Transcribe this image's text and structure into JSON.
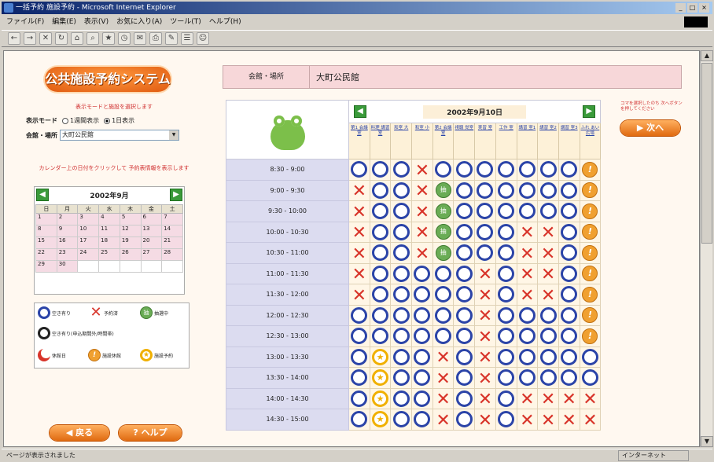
{
  "window": {
    "title": "一括予約 施設予約 - Microsoft Internet Explorer",
    "controls": [
      "_",
      "□",
      "×"
    ]
  },
  "menu": [
    "ファイル(F)",
    "編集(E)",
    "表示(V)",
    "お気に入り(A)",
    "ツール(T)",
    "ヘルプ(H)"
  ],
  "status": {
    "left": "ページが表示されました",
    "zone": "インターネット"
  },
  "left": {
    "logo": "公共施設予約システム",
    "instruction1": "表示モードと施設を選択します",
    "mode_label": "表示モード",
    "mode_options": [
      "1週間表示",
      "1日表示"
    ],
    "hall_label": "会館・場所",
    "hall_value": "大町公民館",
    "instruction2": "カレンダー上の日付をクリックして 予約表情報を表示します",
    "calendar": {
      "title": "2002年9月",
      "weekdays": [
        "日",
        "月",
        "火",
        "水",
        "木",
        "金",
        "土"
      ],
      "weeks": [
        [
          "1",
          "2",
          "3",
          "4",
          "5",
          "6",
          "7"
        ],
        [
          "8",
          "9",
          "10",
          "11",
          "12",
          "13",
          "14"
        ],
        [
          "15",
          "16",
          "17",
          "18",
          "19",
          "20",
          "21"
        ],
        [
          "22",
          "23",
          "24",
          "25",
          "26",
          "27",
          "28"
        ],
        [
          "29",
          "30",
          "",
          "",
          "",
          "",
          ""
        ]
      ]
    },
    "legend": {
      "available": "空き有り",
      "booked": "予約済",
      "pending": "抽選中",
      "partial": "空き有り(申込期間外/時間帯)",
      "closed": "休館日",
      "holiday": "施設休館",
      "sponsored": "施設予約"
    },
    "back_button": "戻る",
    "help_button": "ヘルプ"
  },
  "right": {
    "venue_label": "会館・場所",
    "venue_value": "大町公民館",
    "date_title": "2002年9月10日",
    "next_note": "コマを選択したのち 次へボタンを押してください",
    "next_button": "次へ",
    "rooms": [
      "第1 会議室",
      "料理 講習室",
      "和室 大",
      "和室 小",
      "第2 会議室",
      "視聴 覚室",
      "実習 室",
      "工作 室",
      "講習 室1",
      "講習 室2",
      "講習 室3",
      "ふれ あい 広場"
    ],
    "slots": [
      {
        "time": "8:30 - 9:00",
        "cells": [
          "o",
          "o",
          "o",
          "x",
          "o",
          "o",
          "o",
          "o",
          "o",
          "o",
          "o",
          "!"
        ]
      },
      {
        "time": "9:00 - 9:30",
        "cells": [
          "x",
          "o",
          "o",
          "x",
          "g",
          "o",
          "o",
          "o",
          "o",
          "o",
          "o",
          "!"
        ]
      },
      {
        "time": "9:30 - 10:00",
        "cells": [
          "x",
          "o",
          "o",
          "x",
          "g",
          "o",
          "o",
          "o",
          "o",
          "o",
          "o",
          "!"
        ]
      },
      {
        "time": "10:00 - 10:30",
        "cells": [
          "x",
          "o",
          "o",
          "x",
          "g",
          "o",
          "o",
          "o",
          "x",
          "x",
          "o",
          "!"
        ]
      },
      {
        "time": "10:30 - 11:00",
        "cells": [
          "x",
          "o",
          "o",
          "x",
          "g",
          "o",
          "o",
          "o",
          "x",
          "x",
          "o",
          "!"
        ]
      },
      {
        "time": "11:00 - 11:30",
        "cells": [
          "x",
          "o",
          "o",
          "o",
          "o",
          "o",
          "x",
          "o",
          "x",
          "x",
          "o",
          "!"
        ]
      },
      {
        "time": "11:30 - 12:00",
        "cells": [
          "x",
          "o",
          "o",
          "o",
          "o",
          "o",
          "x",
          "o",
          "x",
          "x",
          "o",
          "!"
        ]
      },
      {
        "time": "12:00 - 12:30",
        "cells": [
          "o",
          "o",
          "o",
          "o",
          "o",
          "o",
          "x",
          "o",
          "o",
          "o",
          "o",
          "!"
        ]
      },
      {
        "time": "12:30 - 13:00",
        "cells": [
          "o",
          "o",
          "o",
          "o",
          "o",
          "o",
          "x",
          "o",
          "o",
          "o",
          "o",
          "!"
        ]
      },
      {
        "time": "13:00 - 13:30",
        "cells": [
          "o",
          "s",
          "o",
          "o",
          "x",
          "o",
          "x",
          "o",
          "o",
          "o",
          "o",
          "o"
        ]
      },
      {
        "time": "13:30 - 14:00",
        "cells": [
          "o",
          "s",
          "o",
          "o",
          "x",
          "o",
          "x",
          "o",
          "o",
          "o",
          "o",
          "o"
        ]
      },
      {
        "time": "14:00 - 14:30",
        "cells": [
          "o",
          "s",
          "o",
          "o",
          "x",
          "o",
          "x",
          "o",
          "x",
          "x",
          "x",
          "x"
        ]
      },
      {
        "time": "14:30 - 15:00",
        "cells": [
          "o",
          "s",
          "o",
          "o",
          "x",
          "o",
          "x",
          "o",
          "x",
          "x",
          "x",
          "x"
        ]
      }
    ]
  },
  "icons": {
    "prev": "arrow-left-icon",
    "next": "arrow-right-icon",
    "frog": "frog-mascot"
  },
  "colors": {
    "accent": "#e06a10",
    "circle": "#2b44a8",
    "cross": "#d8342a",
    "pending": "#6aac55",
    "venue_bar": "#f7d7d9",
    "time_col": "#dcdcf0"
  }
}
